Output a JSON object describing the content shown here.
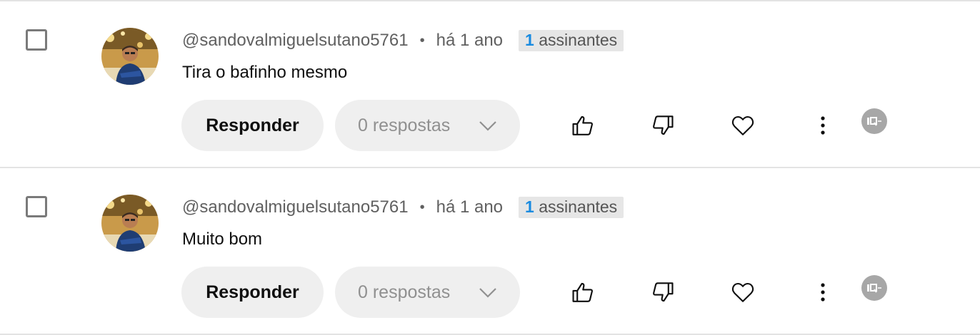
{
  "comments": [
    {
      "handle": "@sandovalmiguelsutano5761",
      "separator": "•",
      "time": "há 1 ano",
      "subscriber_count": "1",
      "subscriber_label": "assinantes",
      "text": "Tira o bafinho mesmo",
      "reply_label": "Responder",
      "replies_label": "0 respostas"
    },
    {
      "handle": "@sandovalmiguelsutano5761",
      "separator": "•",
      "time": "há 1 ano",
      "subscriber_count": "1",
      "subscriber_label": "assinantes",
      "text": "Muito bom",
      "reply_label": "Responder",
      "replies_label": "0 respostas"
    }
  ],
  "icons": {
    "checkbox": "checkbox-icon",
    "avatar": "avatar-photo",
    "chevron": "chevron-down-icon",
    "like": "thumbs-up-icon",
    "dislike": "thumbs-down-icon",
    "heart": "heart-icon",
    "more": "more-vert-icon",
    "extension": "extension-badge-icon"
  },
  "colors": {
    "accent_count": "#1a8be0",
    "badge_bg": "#e6e6e6",
    "button_bg": "#efefef",
    "secondary_text": "#606060"
  }
}
